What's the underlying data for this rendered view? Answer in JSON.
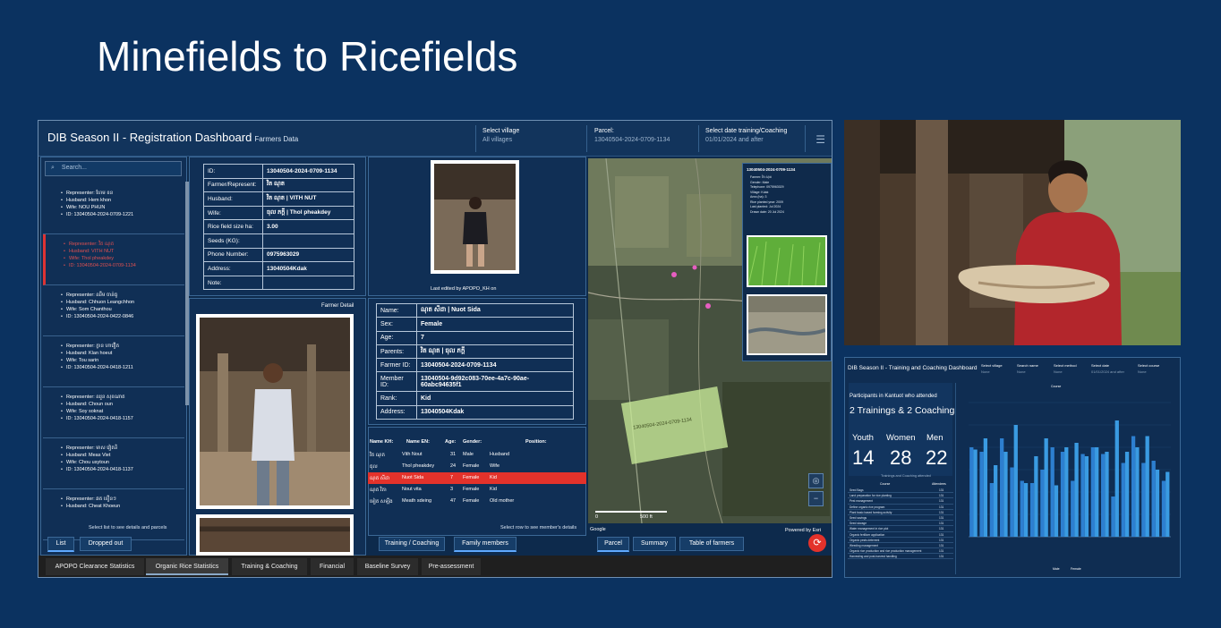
{
  "slide": {
    "title": "Minefields to Ricefields"
  },
  "dashboard": {
    "title": "DIB Season II - Registration Dashboard",
    "subtitle": "Farmers Data",
    "selects": [
      {
        "label": "Select village",
        "value": "All villages"
      },
      {
        "label": "Parcel:",
        "value": "13040504-2024-0709-1134"
      },
      {
        "label": "Select date training/Coaching",
        "value": "01/01/2024 and after"
      }
    ],
    "search_placeholder": "Search...",
    "farmers": [
      {
        "rep": "Representer: ហែម ខន",
        "husband": "Husband: Hem khon",
        "wife": "Wife: NOU PHUN",
        "id": "ID: 13040504-2024-0709-1221"
      },
      {
        "rep": "Representer: វិត ណុត",
        "husband": "Husband: VITH NUT",
        "wife": "Wife: Thol pheakdey",
        "id": "ID: 13040504-2024-0709-1134"
      },
      {
        "rep": "Representer: ឈឹម ចាន់ធូ",
        "husband": "Husband: Chhuon Leangchhon",
        "wife": "Wife: Som Chanthou",
        "id": "ID: 13040504-2024-0422-0846"
      },
      {
        "rep": "Representer: ក្លាន ហាវឿត",
        "husband": "Husband: Klan hoeut",
        "wife": "Wife: Tou sarin",
        "id": "ID: 13040504-2024-0418-1211"
      },
      {
        "rep": "Representer: ឈួន សុខណាត",
        "husband": "Husband: Choun oun",
        "wife": "Wife: Soy soknat",
        "id": "ID: 13040504-2024-0418-1157"
      },
      {
        "rep": "Representer: មាស វៀតនិ",
        "husband": "Husband: Meas Viet",
        "wife": "Wife: Chou usytoun",
        "id": "ID: 13040504-2024-0418-1137"
      },
      {
        "rep": "Representer: ឆត ខឿនៗ",
        "husband": "Husband: Cheat Khoeun",
        "wife": "",
        "id": ""
      }
    ],
    "list_note": "Select list to see details and parcels",
    "list_buttons": [
      "List",
      "Dropped out"
    ],
    "farmer_table": [
      {
        "k": "ID:",
        "v": "13040504-2024-0709-1134"
      },
      {
        "k": "Farmer/Represent:",
        "v": "វិត ណុត"
      },
      {
        "k": "Husband:",
        "v": "វិត ណុត | VITH NUT"
      },
      {
        "k": "Wife:",
        "v": "ធុល ភក្តី | Thol pheakdey"
      },
      {
        "k": "Rice field size ha:",
        "v": "3.00"
      },
      {
        "k": "Seeds (KG):",
        "v": ""
      },
      {
        "k": "Phone Number:",
        "v": "0975963029"
      },
      {
        "k": "Address:",
        "v": "13040504Kdak"
      },
      {
        "k": "Note:",
        "v": ""
      }
    ],
    "farmer_detail_label": "Farmer Detail",
    "last_edited": "Last edited by APOPO_KH on",
    "member_table": [
      {
        "k": "Name:",
        "v": "ណុត សីដា | Nuot Sida"
      },
      {
        "k": "Sex:",
        "v": "Female"
      },
      {
        "k": "Age:",
        "v": "7"
      },
      {
        "k": "Parents:",
        "v": "វិត ណុត | ធុល ភក្តី"
      },
      {
        "k": "Farmer ID:",
        "v": "13040504-2024-0709-1134"
      },
      {
        "k": "Member ID:",
        "v": "13040504-9d92c083-70ee-4a7c-90ae-60abc94635f1"
      },
      {
        "k": "Rank:",
        "v": "Kid"
      },
      {
        "k": "Address:",
        "v": "13040504Kdak"
      }
    ],
    "family_headers": [
      "Name KH:",
      "Name EN:",
      "Age:",
      "Gender:",
      "Position:"
    ],
    "family_rows": [
      [
        "វិត ណុត",
        "Vith Nout",
        "31",
        "Male",
        "Husband"
      ],
      [
        "ធុល",
        "Thol pheakdey",
        "24",
        "Female",
        "Wife"
      ],
      [
        "ណុត សីដា",
        "Nuot Sida",
        "7",
        "Female",
        "Kid"
      ],
      [
        "ណុត វិតា",
        "Nout vita",
        "3",
        "Female",
        "Kid"
      ],
      [
        "មៀត សឡឹង",
        "Meath sdeing",
        "47",
        "Female",
        "Old mother"
      ]
    ],
    "family_note": "Select row to see member's details",
    "member_buttons": [
      "Training / Coaching",
      "Family members"
    ],
    "map": {
      "popup_id": "13040504-2024-0709-1134",
      "popup_lines": [
        "Farmer: វិត ណុត",
        "Gender: Male",
        "Telephone: 0975963029",
        "Village: Kdak",
        "Area (ha): 3",
        "Rice planted year: 2009",
        "Last planted: Jul 2024",
        "Drawn date: 20 Jul 2024"
      ],
      "parcel_label": "13040504-2024-0709-1134",
      "scale_left": "0",
      "scale_right": "500 ft",
      "google": "Google",
      "esri": "Powered by Esri"
    },
    "map_buttons": [
      "Parcel",
      "Summary",
      "Table of farmers"
    ],
    "bottom_tabs": [
      "APOPO Clearance Statistics",
      "Organic Rice Statistics",
      "Training & Coaching",
      "Financial",
      "Baseline Survey",
      "Pre-assessment"
    ]
  },
  "training": {
    "title": "DIB Season II - Training and Coaching Dashboard",
    "selects": [
      {
        "label": "Select village",
        "value": "None"
      },
      {
        "label": "Search name",
        "value": "None"
      },
      {
        "label": "Select method",
        "value": "None"
      },
      {
        "label": "Select date",
        "value": "01/01/2024 and after"
      },
      {
        "label": "Select course",
        "value": "None"
      }
    ],
    "participants_line": "Participants in Kantuot who attended",
    "big_line": "2 Trainings & 2 Coachings",
    "stats": [
      {
        "label": "Youth",
        "value": "14"
      },
      {
        "label": "Women",
        "value": "28"
      },
      {
        "label": "Men",
        "value": "22"
      }
    ],
    "stats_note": "Trainings and Coaching attended",
    "course_header": "Course",
    "attendees_header": "Attendees",
    "course_rows": [
      [
        "Seed Bags",
        "131"
      ],
      [
        "Land preparation for rice planting",
        "131"
      ],
      [
        "Pest management",
        "131"
      ],
      [
        "Define organic rice program",
        "131"
      ],
      [
        "Plant basic based farming activity",
        "131"
      ],
      [
        "Seed savings",
        "131"
      ],
      [
        "Seed storage",
        "131"
      ],
      [
        "Water management in rice plot",
        "131"
      ],
      [
        "Organic fertilizer application",
        "131"
      ],
      [
        "Organic pests deterrent",
        "131"
      ],
      [
        "Weeding management",
        "131"
      ],
      [
        "Organic rice production and rice production management",
        "131"
      ],
      [
        "Harvesting and post-harvest handling",
        "131"
      ]
    ],
    "chart_data": {
      "type": "bar",
      "title": "Course",
      "categories": [
        "c1",
        "c2",
        "c3",
        "c4",
        "c5",
        "c6",
        "c7",
        "c8",
        "c9",
        "c10",
        "c11",
        "c12",
        "c13",
        "c14",
        "c15",
        "c16",
        "c17",
        "c18",
        "c19",
        "c20"
      ],
      "series": [
        {
          "name": "Male",
          "color": "#2d7fd0",
          "values": [
            40,
            38,
            24,
            44,
            31,
            25,
            24,
            30,
            40,
            38,
            25,
            37,
            40,
            37,
            18,
            33,
            45,
            33,
            34,
            25
          ]
        },
        {
          "name": "Female",
          "color": "#3a9be2",
          "values": [
            39,
            44,
            32,
            38,
            50,
            24,
            36,
            44,
            23,
            40,
            42,
            36,
            40,
            38,
            52,
            38,
            40,
            45,
            30,
            29
          ]
        }
      ],
      "legend": [
        "Male",
        "Female"
      ],
      "ylim": [
        0,
        60
      ]
    }
  }
}
